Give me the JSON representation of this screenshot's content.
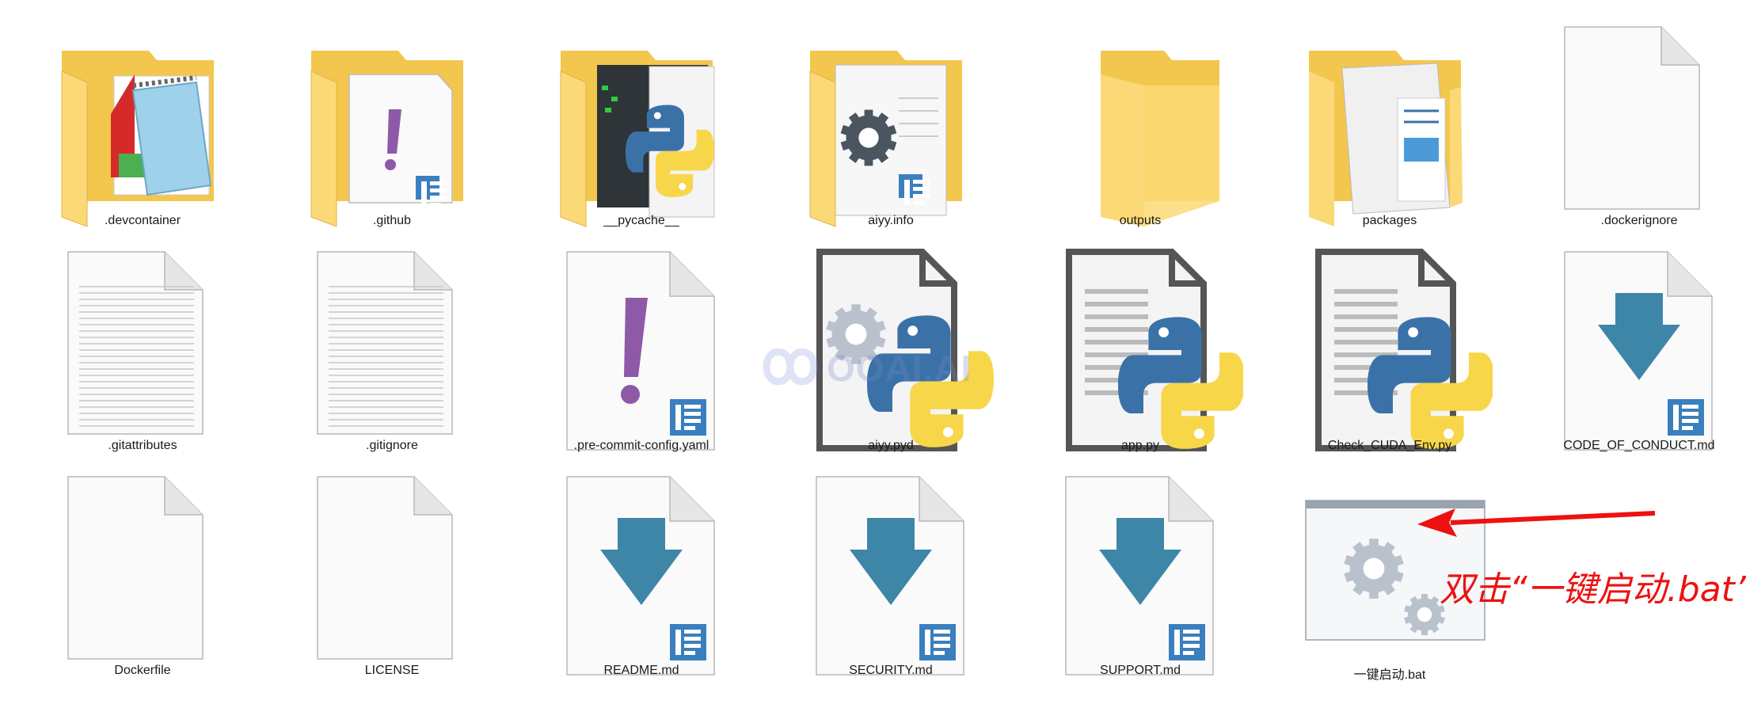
{
  "items": [
    {
      "label": ".devcontainer",
      "icon": "folder-notepad-icon",
      "type": "folder"
    },
    {
      "label": ".github",
      "icon": "folder-yaml-icon",
      "type": "folder"
    },
    {
      "label": "__pycache__",
      "icon": "folder-python-icon",
      "type": "folder"
    },
    {
      "label": "aiyy.info",
      "icon": "folder-settings-icon",
      "type": "folder"
    },
    {
      "label": "outputs",
      "icon": "folder-icon",
      "type": "folder"
    },
    {
      "label": "packages",
      "icon": "folder-documents-icon",
      "type": "folder"
    },
    {
      "label": ".dockerignore",
      "icon": "blank-file-icon",
      "type": "file"
    },
    {
      "label": ".gitattributes",
      "icon": "text-file-icon",
      "type": "file"
    },
    {
      "label": ".gitignore",
      "icon": "text-file-icon",
      "type": "file"
    },
    {
      "label": ".pre-commit-config.yaml",
      "icon": "yaml-file-icon",
      "type": "file"
    },
    {
      "label": "aiyy.pyd",
      "icon": "python-extension-icon",
      "type": "file"
    },
    {
      "label": "app.py",
      "icon": "python-script-icon",
      "type": "file"
    },
    {
      "label": "Check_CUDA_Env.py",
      "icon": "python-script-icon",
      "type": "file"
    },
    {
      "label": "CODE_OF_CONDUCT.md",
      "icon": "markdown-file-icon",
      "type": "file"
    },
    {
      "label": "Dockerfile",
      "icon": "blank-file-icon",
      "type": "file"
    },
    {
      "label": "LICENSE",
      "icon": "blank-file-icon",
      "type": "file"
    },
    {
      "label": "README.md",
      "icon": "markdown-file-icon",
      "type": "file"
    },
    {
      "label": "SECURITY.md",
      "icon": "markdown-file-icon",
      "type": "file"
    },
    {
      "label": "SUPPORT.md",
      "icon": "markdown-file-icon",
      "type": "file"
    },
    {
      "label": "一键启动.bat",
      "icon": "batch-file-icon",
      "type": "file"
    }
  ],
  "watermark": {
    "text": "OOAI.AI"
  },
  "annotation": {
    "text": "双击“一键启动.bat”",
    "color": "#ee1111"
  },
  "colors": {
    "folder_back": "#f3c64d",
    "folder_front": "#fbd977",
    "python_blue": "#3a72a8",
    "python_yellow": "#f7d64a",
    "markdown_blue": "#3a7fbf",
    "download_teal": "#3d86a8",
    "yaml_purple": "#8e5aa8",
    "gear_gray": "#b9c2cc"
  }
}
